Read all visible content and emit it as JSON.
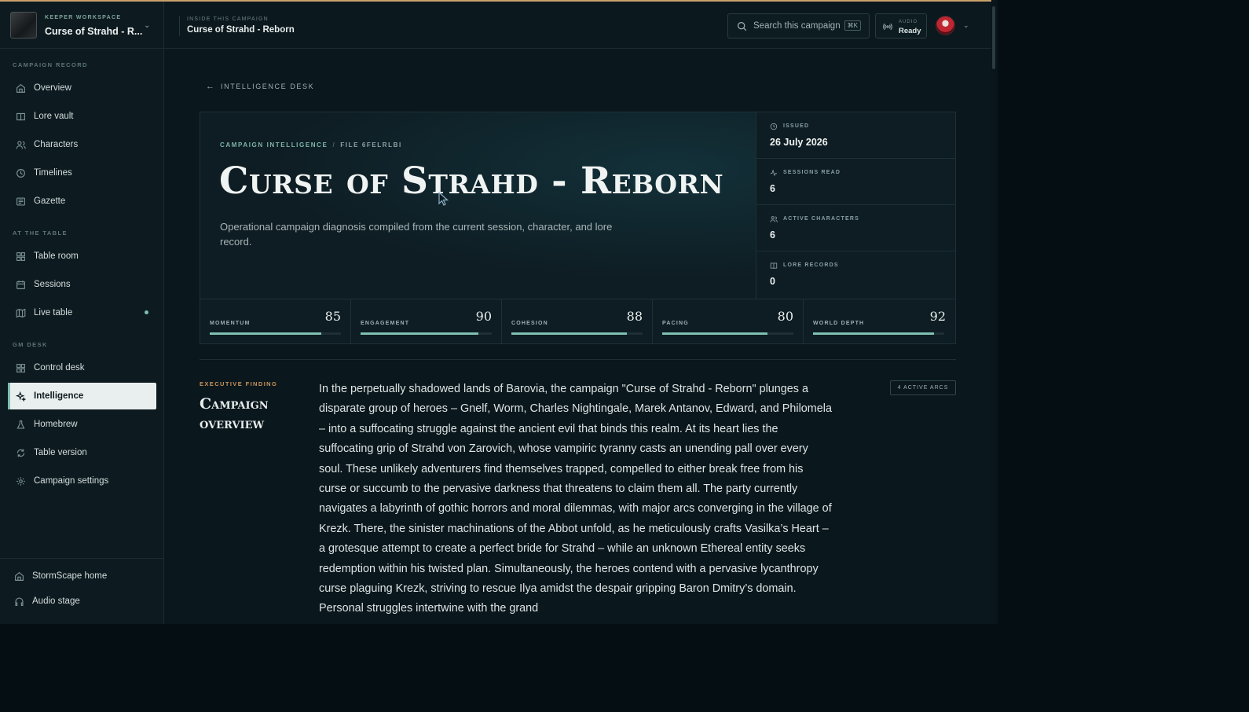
{
  "workspace": {
    "kicker": "KEEPER WORKSPACE",
    "title": "Curse of Strahd - R..."
  },
  "sidebar": {
    "sections": [
      {
        "label": "CAMPAIGN RECORD"
      },
      {
        "label": "AT THE TABLE"
      },
      {
        "label": "GM DESK"
      }
    ],
    "items": [
      {
        "label": "Overview",
        "icon": "home-icon"
      },
      {
        "label": "Lore vault",
        "icon": "book-icon"
      },
      {
        "label": "Characters",
        "icon": "users-icon"
      },
      {
        "label": "Timelines",
        "icon": "clock-icon"
      },
      {
        "label": "Gazette",
        "icon": "newspaper-icon"
      },
      {
        "label": "Table room",
        "icon": "grid-icon"
      },
      {
        "label": "Sessions",
        "icon": "calendar-icon"
      },
      {
        "label": "Live table",
        "icon": "map-icon"
      },
      {
        "label": "Control desk",
        "icon": "grid-icon"
      },
      {
        "label": "Intelligence",
        "icon": "sparkle-icon",
        "active": true
      },
      {
        "label": "Homebrew",
        "icon": "flask-icon"
      },
      {
        "label": "Table version",
        "icon": "refresh-icon"
      },
      {
        "label": "Campaign settings",
        "icon": "gear-icon"
      }
    ],
    "footer": [
      {
        "label": "StormScape home",
        "icon": "home-icon"
      },
      {
        "label": "Audio stage",
        "icon": "headphones-icon"
      }
    ]
  },
  "topbar": {
    "kicker": "INSIDE THIS CAMPAIGN",
    "title": "Curse of Strahd - Reborn",
    "search_placeholder": "Search this campaign",
    "search_shortcut": "⌘K",
    "audio_kicker": "AUDIO",
    "audio_status": "Ready"
  },
  "main": {
    "back_label": "INTELLIGENCE DESK",
    "kicker": "CAMPAIGN INTELLIGENCE",
    "kicker_sep": "/",
    "file_label": "FILE 6FELRLBI",
    "title": "Curse of Strahd - Reborn",
    "description": "Operational campaign diagnosis compiled from the current session, character, and lore record.",
    "stats": [
      {
        "label": "ISSUED",
        "value": "26 July 2026",
        "icon": "clock-icon"
      },
      {
        "label": "SESSIONS READ",
        "value": "6",
        "icon": "activity-icon"
      },
      {
        "label": "ACTIVE CHARACTERS",
        "value": "6",
        "icon": "users-icon"
      },
      {
        "label": "LORE RECORDS",
        "value": "0",
        "icon": "book-icon"
      }
    ],
    "metrics": [
      {
        "label": "MOMENTUM",
        "value": "85",
        "fraction": 0.85
      },
      {
        "label": "ENGAGEMENT",
        "value": "90",
        "fraction": 0.9
      },
      {
        "label": "COHESION",
        "value": "88",
        "fraction": 0.88
      },
      {
        "label": "PACING",
        "value": "80",
        "fraction": 0.8
      },
      {
        "label": "WORLD DEPTH",
        "value": "92",
        "fraction": 0.92
      }
    ],
    "exec_kicker": "EXECUTIVE FINDING",
    "exec_title": "Campaign overview",
    "arcs_badge": "4 ACTIVE ARCS",
    "overview": "In the perpetually shadowed lands of Barovia, the campaign \"Curse of Strahd - Reborn\" plunges a disparate group of heroes – Gnelf, Worm, Charles Nightingale, Marek Antanov, Edward, and Philomela – into a suffocating struggle against the ancient evil that binds this realm. At its heart lies the suffocating grip of Strahd von Zarovich, whose vampiric tyranny casts an unending pall over every soul. These unlikely adventurers find themselves trapped, compelled to either break free from his curse or succumb to the pervasive darkness that threatens to claim them all. The party currently navigates a labyrinth of gothic horrors and moral dilemmas, with major arcs converging in the village of Krezk. There, the sinister machinations of the Abbot unfold, as he meticulously crafts Vasilka’s Heart – a grotesque attempt to create a perfect bride for Strahd – while an unknown Ethereal entity seeks redemption within his twisted plan. Simultaneously, the heroes contend with a pervasive lycanthropy curse plaguing Krezk, striving to rescue Ilya amidst the despair gripping Baron Dmitry’s domain. Personal struggles intertwine with the grand"
  },
  "colors": {
    "accent": "#7fc1b1",
    "gold": "#c9a06a",
    "exec": "#c9935a",
    "bg": "#0a171c"
  }
}
